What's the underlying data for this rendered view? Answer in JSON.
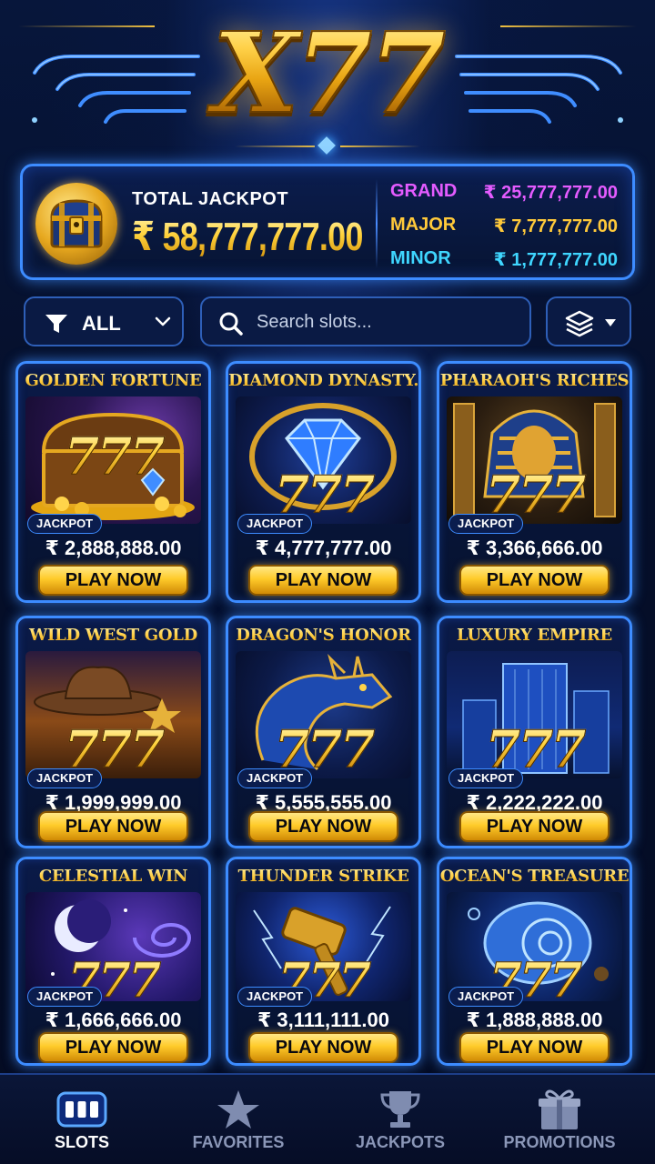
{
  "header": {
    "logo_text": "X77"
  },
  "jackpot": {
    "total_label": "TOTAL JACKPOT",
    "total_amount": "₹ 58,777,777.00",
    "tiers": [
      {
        "name": "GRAND",
        "value": "₹ 25,777,777.00",
        "color": "#e45bff"
      },
      {
        "name": "MAJOR",
        "value": "₹ 7,777,777.00",
        "color": "#ffc93a"
      },
      {
        "name": "MINOR",
        "value": "₹ 1,777,777.00",
        "color": "#3fd6ff"
      }
    ]
  },
  "filter": {
    "category_label": "ALL",
    "search_placeholder": "Search slots..."
  },
  "games": [
    {
      "title": "GOLDEN FORTUNE",
      "badge": "JACKPOT",
      "amount": "₹ 2,888,888.00",
      "button": "PLAY NOW",
      "art_text": "777"
    },
    {
      "title": "DIAMOND DYNASTY.",
      "badge": "JACKPOT",
      "amount": "₹ 4,777,777.00",
      "button": "PLAY NOW",
      "art_text": "777"
    },
    {
      "title": "PHARAOH'S RICHES",
      "badge": "JACKPOT",
      "amount": "₹ 3,366,666.00",
      "button": "PLAY NOW",
      "art_text": "777"
    },
    {
      "title": "WILD WEST GOLD",
      "badge": "JACKPOT",
      "amount": "₹ 1,999,999.00",
      "button": "PLAY NOW",
      "art_text": "777"
    },
    {
      "title": "DRAGON'S HONOR",
      "badge": "JACKPOT",
      "amount": "₹ 5,555,555.00",
      "button": "PLAY NOW",
      "art_text": "777"
    },
    {
      "title": "LUXURY EMPIRE",
      "badge": "JACKPOT",
      "amount": "₹ 2,222,222.00",
      "button": "PLAY NOW",
      "art_text": "777"
    },
    {
      "title": "CELESTIAL WIN",
      "badge": "JACKPOT",
      "amount": "₹ 1,666,666.00",
      "button": "PLAY NOW",
      "art_text": "777"
    },
    {
      "title": "THUNDER STRIKE",
      "badge": "JACKPOT",
      "amount": "₹ 3,111,111.00",
      "button": "PLAY NOW",
      "art_text": "777"
    },
    {
      "title": "OCEAN'S TREASURE",
      "badge": "JACKPOT",
      "amount": "₹ 1,888,888.00",
      "button": "PLAY NOW",
      "art_text": "777"
    }
  ],
  "nav": [
    {
      "label": "SLOTS",
      "icon": "slot-machine-icon",
      "active": true
    },
    {
      "label": "FAVORITES",
      "icon": "star-icon",
      "active": false
    },
    {
      "label": "JACKPOTS",
      "icon": "trophy-icon",
      "active": false
    },
    {
      "label": "PROMOTIONS",
      "icon": "gift-icon",
      "active": false
    }
  ],
  "colors": {
    "accent_blue": "#3d8cff",
    "gold": "#ffcf45",
    "background": "#05102a"
  }
}
